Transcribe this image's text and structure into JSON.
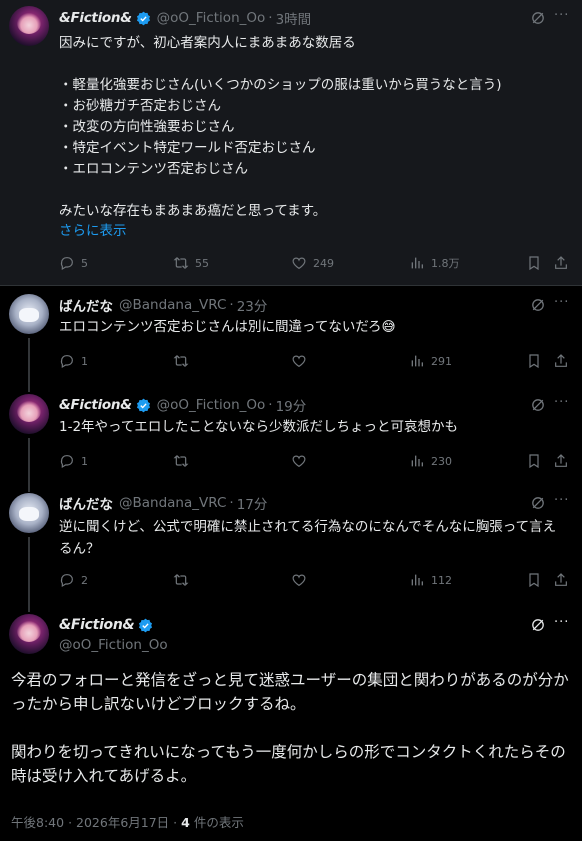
{
  "tweets": [
    {
      "name": "&Fiction&",
      "handle": "@oO_Fiction_Oo",
      "time": "3時間",
      "text": "因みにですが、初心者案内人にまあまあな数居る\n\n・軽量化強要おじさん(いくつかのショップの服は重いから買うなと言う)\n・お砂糖ガチ否定おじさん\n・改変の方向性強要おじさん\n・特定イベント特定ワールド否定おじさん\n・エロコンテンツ否定おじさん\n\nみたいな存在もまあまあ癌だと思ってます。",
      "show_more": "さらに表示",
      "replies": "5",
      "retweets": "55",
      "likes": "249",
      "views": "1.8万"
    },
    {
      "name": "ばんだな",
      "handle": "@Bandana_VRC",
      "time": "23分",
      "text": "エロコンテンツ否定おじさんは別に間違ってないだろ😅",
      "replies": "1",
      "retweets": "",
      "likes": "",
      "views": "291"
    },
    {
      "name": "&Fiction&",
      "handle": "@oO_Fiction_Oo",
      "time": "19分",
      "text": "1-2年やってエロしたことないなら少数派だしちょっと可哀想かも",
      "replies": "1",
      "retweets": "",
      "likes": "",
      "views": "230"
    },
    {
      "name": "ばんだな",
      "handle": "@Bandana_VRC",
      "time": "17分",
      "text": "逆に聞くけど、公式で明確に禁止されてる行為なのになんでそんなに胸張って言えるん？",
      "replies": "2",
      "retweets": "",
      "likes": "",
      "views": "112"
    }
  ],
  "main": {
    "name": "&Fiction&",
    "handle": "@oO_Fiction_Oo",
    "text": "今君のフォローと発信をざっと見て迷惑ユーザーの集団と関わりがあるのが分かったから申し訳ないけどブロックするね。\n\n関わりを切ってきれいになってもう一度何かしらの形でコンタクトくれたらその時は受け入れてあげるよ。",
    "time": "午後8:40",
    "date": "2026年6月17日",
    "views_count": "4",
    "views_label": "件の表示"
  },
  "colors": {
    "accent": "#1d9bf0",
    "muted": "#71767b",
    "background": "#000000"
  },
  "icons": [
    "verified-badge-icon",
    "grok-icon",
    "more-icon",
    "reply-icon",
    "retweet-icon",
    "like-icon",
    "views-icon",
    "bookmark-icon",
    "share-icon"
  ]
}
